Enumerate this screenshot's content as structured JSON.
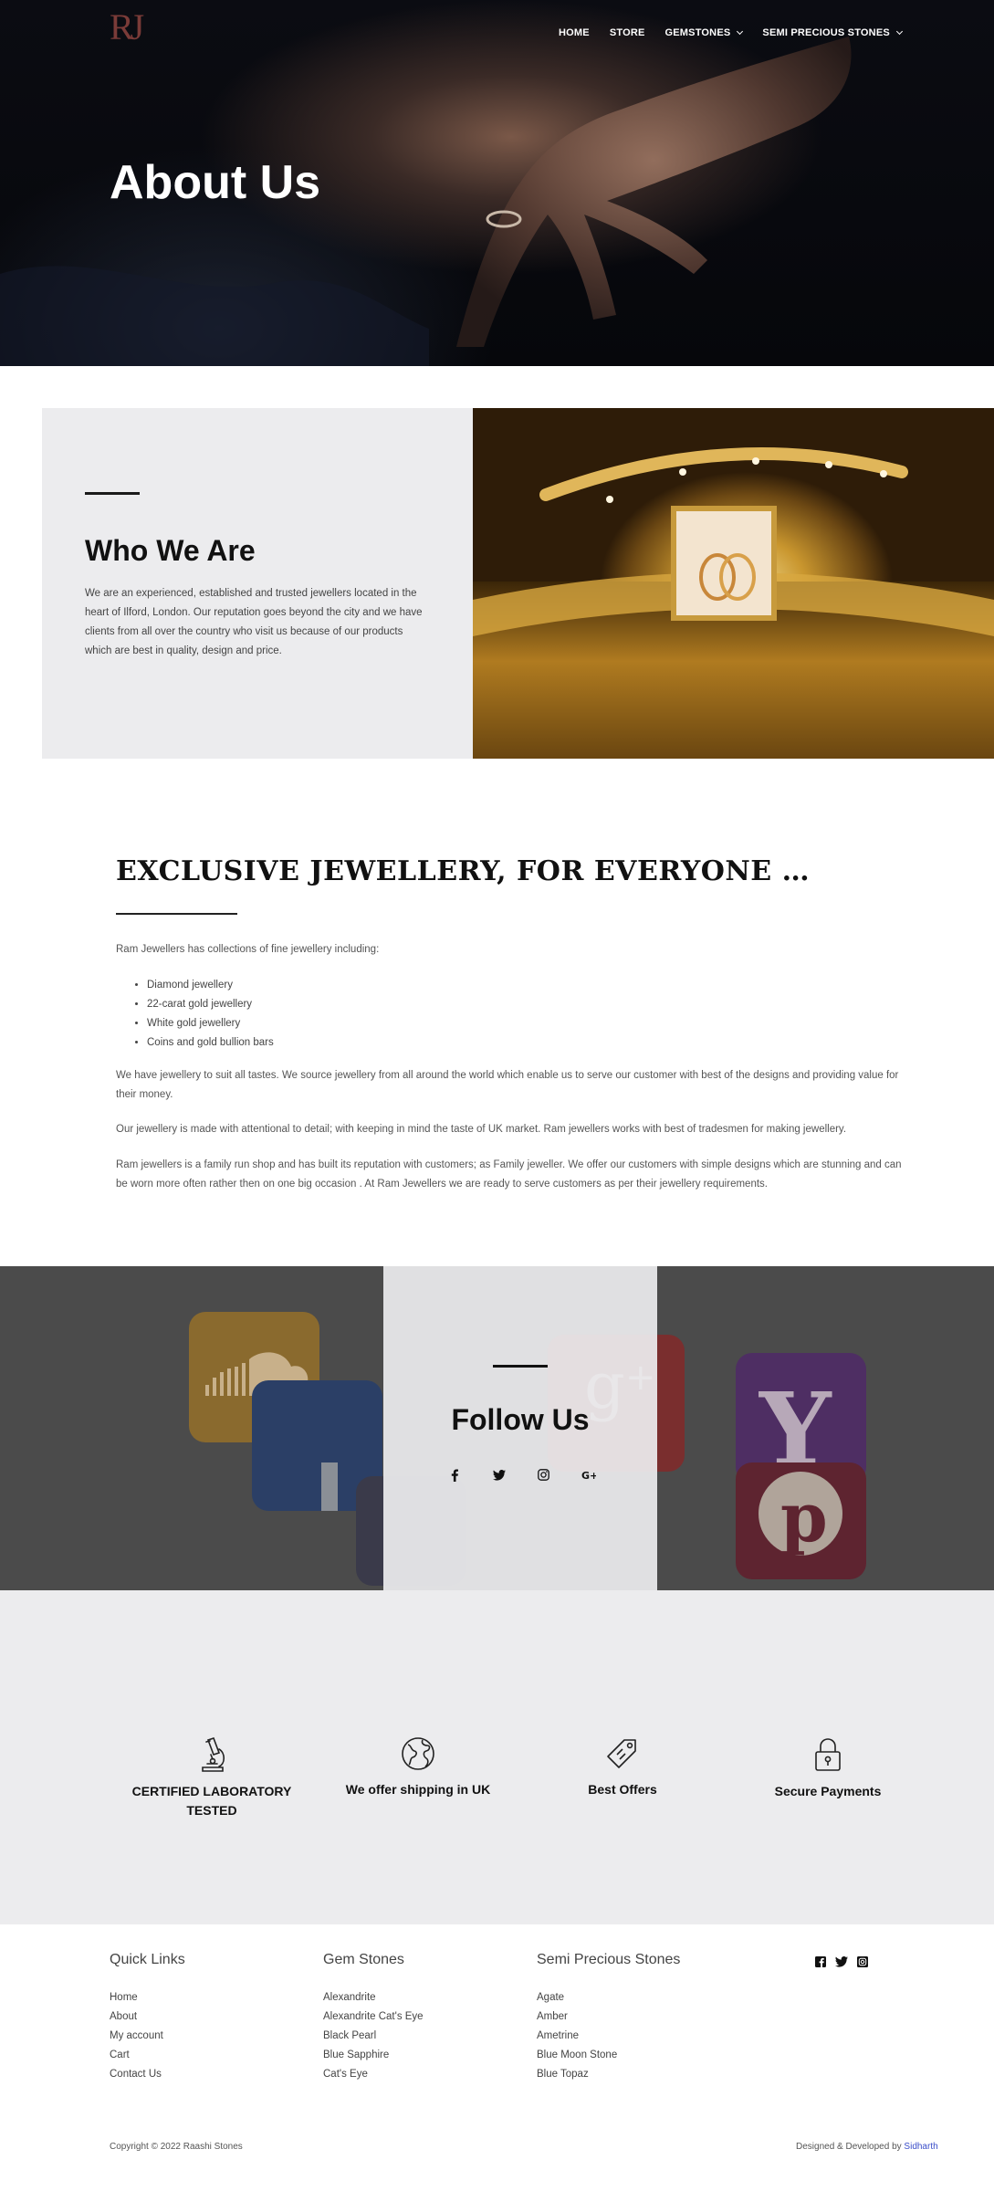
{
  "header": {
    "logo_text": "RJ",
    "nav": [
      {
        "label": "HOME",
        "has_dropdown": false
      },
      {
        "label": "STORE",
        "has_dropdown": false
      },
      {
        "label": "GEMSTONES",
        "has_dropdown": true
      },
      {
        "label": "SEMI PRECIOUS STONES",
        "has_dropdown": true
      }
    ]
  },
  "hero": {
    "title": "About Us"
  },
  "who": {
    "title": "Who We Are",
    "text": "We are an experienced, established and trusted jewellers located in the heart of Ilford, London. Our reputation goes beyond the city and we have clients from all over the country  who visit us because of our products which are best in quality, design and price."
  },
  "exclusive": {
    "title": "EXCLUSIVE JEWELLERY, FOR EVERYONE …",
    "intro": "Ram Jewellers has collections of fine jewellery including:",
    "items": [
      "Diamond jewellery",
      "22-carat gold jewellery",
      "White gold jewellery",
      "Coins and gold bullion bars"
    ],
    "p1": "We have jewellery to suit all tastes.  We source jewellery from all around the world which enable us to serve our customer with best of the designs and providing value for their money.",
    "p2": "Our jewellery is  made with attentional to detail; with keeping in mind the taste of UK market.  Ram jewellers works with best of tradesmen for  making jewellery.",
    "p3": "Ram jewellers is a family run shop and has built its reputation with customers; as Family jeweller. We offer our customers  with simple designs which are stunning and can be worn more often rather then on one big occasion . At Ram Jewellers we are ready to serve customers as per their jewellery requirements."
  },
  "follow": {
    "title": "Follow Us",
    "icons": [
      "facebook-icon",
      "twitter-icon",
      "instagram-icon",
      "google-plus-icon"
    ]
  },
  "features": [
    {
      "icon": "microscope-icon",
      "label": "CERTIFIED LABORATORY TESTED"
    },
    {
      "icon": "globe-icon",
      "label": "We offer shipping in UK"
    },
    {
      "icon": "tag-icon",
      "label": "Best Offers"
    },
    {
      "icon": "lock-icon",
      "label": "Secure Payments"
    }
  ],
  "footer": {
    "quick_links": {
      "title": "Quick Links",
      "links": [
        "Home",
        "About",
        "My account",
        "Cart",
        "Contact Us"
      ]
    },
    "gem_stones": {
      "title": "Gem Stones",
      "links": [
        "Alexandrite",
        "Alexandrite Cat's Eye",
        "Black Pearl",
        "Blue Sapphire",
        "Cat's Eye"
      ]
    },
    "semi_precious": {
      "title": "Semi Precious Stones",
      "links": [
        "Agate",
        "Amber",
        "Ametrine",
        "Blue Moon Stone",
        "Blue Topaz"
      ]
    },
    "copyright": "Copyright © 2022 Raashi Stones",
    "credit_prefix": "Designed & Developed by ",
    "credit_name": "Sidharth"
  }
}
